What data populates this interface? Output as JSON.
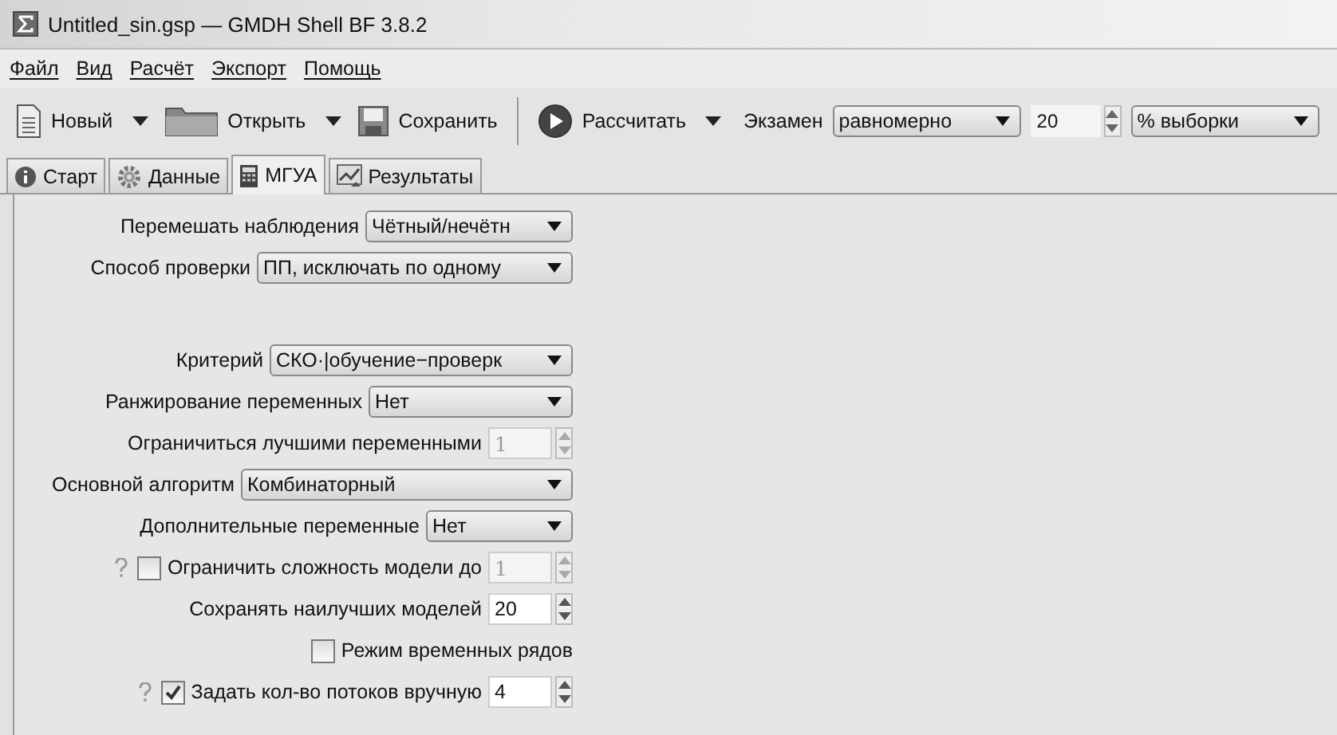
{
  "window": {
    "title": "Untitled_sin.gsp — GMDH Shell BF 3.8.2"
  },
  "menu": [
    "Файл",
    "Вид",
    "Расчёт",
    "Экспорт",
    "Помощь"
  ],
  "toolbar": [
    {
      "kind": "button",
      "label": "Новый",
      "dropdown": true
    },
    {
      "kind": "button",
      "label": "Открыть",
      "dropdown": true
    },
    {
      "kind": "button",
      "label": "Сохранить",
      "dropdown": false
    },
    {
      "kind": "separator"
    },
    {
      "kind": "button",
      "label": "Рассчитать",
      "dropdown": true
    },
    {
      "kind": "label",
      "label": "Экзамен"
    },
    {
      "kind": "combo",
      "value": "равномерно"
    },
    {
      "kind": "spin",
      "value": "20"
    },
    {
      "kind": "combo",
      "value": "% выборки"
    }
  ],
  "tabs": [
    {
      "label": "Старт",
      "selected": false
    },
    {
      "label": "Данные",
      "selected": false
    },
    {
      "label": "МГУА",
      "selected": true
    },
    {
      "label": "Результаты",
      "selected": false
    }
  ],
  "settings": [
    {
      "kind": "combo",
      "label": "Перемешать наблюдения",
      "value": "Чётный/нечётн"
    },
    {
      "kind": "combo",
      "label": "Способ проверки",
      "value": "ПП, исключать по одному"
    },
    {
      "kind": "combo",
      "label": "Критерий",
      "value": "СКО·|обучение−проверк",
      "gap_before": true
    },
    {
      "kind": "combo",
      "label": "Ранжирование переменных",
      "value": "Нет"
    },
    {
      "kind": "spin",
      "label": "Ограничиться лучшими переменными",
      "value": "1",
      "disabled": true
    },
    {
      "kind": "combo",
      "label": "Основной алгоритм",
      "value": "Комбинаторный"
    },
    {
      "kind": "combo",
      "label": "Дополнительные переменные",
      "value": "Нет"
    },
    {
      "kind": "check-spin",
      "label": "Ограничить сложность модели до",
      "checked": false,
      "help": true,
      "value": "1",
      "disabled": true
    },
    {
      "kind": "spin",
      "label": "Сохранять наилучших моделей",
      "value": "20",
      "disabled": false
    },
    {
      "kind": "check",
      "label": "Режим временных рядов",
      "checked": false
    },
    {
      "kind": "check-spin",
      "label": "Задать кол-во потоков вручную",
      "checked": true,
      "help": true,
      "value": "4",
      "disabled": false
    }
  ]
}
